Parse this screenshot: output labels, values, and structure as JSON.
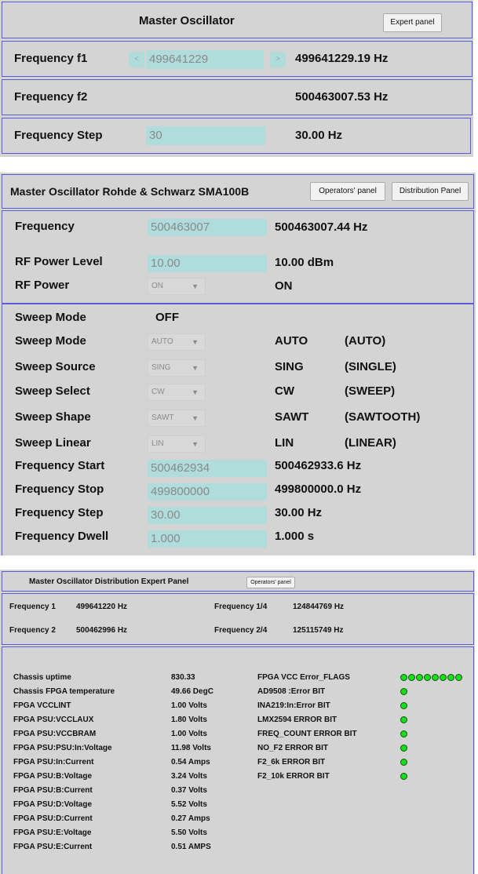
{
  "p1": {
    "title": "Master Oscillator",
    "expert_btn": "Expert panel",
    "f1_label": "Frequency f1",
    "f1_input": "499641229",
    "f1_dec": "<",
    "f1_inc": ">",
    "f1_value": "499641229.19 Hz",
    "f2_label": "Frequency f2",
    "f2_value": "500463007.53 Hz",
    "step_label": "Frequency Step",
    "step_input": "30",
    "step_value": "30.00 Hz"
  },
  "p2": {
    "title": "Master Oscillator Rohde & Schwarz  SMA100B",
    "operators_btn": "Operators' panel",
    "distribution_btn": "Distribution Panel",
    "freq_label": "Frequency",
    "freq_input": "500463007",
    "freq_value": "500463007.44 Hz",
    "rfpl_label": "RF Power Level",
    "rfpl_input": "10.00",
    "rfpl_value": "10.00 dBm",
    "rfp_label": "RF Power",
    "rfp_select": "ON",
    "rfp_value": "ON",
    "sweep_mode_state_label": "Sweep Mode",
    "sweep_mode_state": "OFF",
    "rows": [
      {
        "label": "Sweep Mode",
        "select": "AUTO",
        "value": "AUTO",
        "desc": "(AUTO)"
      },
      {
        "label": "Sweep Source",
        "select": "SING",
        "value": "SING",
        "desc": "(SINGLE)"
      },
      {
        "label": "Sweep Select",
        "select": "CW",
        "value": "CW",
        "desc": "(SWEEP)"
      },
      {
        "label": "Sweep Shape",
        "select": "SAWT",
        "value": "SAWT",
        "desc": "(SAWTOOTH)"
      },
      {
        "label": "Sweep Linear",
        "select": "LIN",
        "value": "LIN",
        "desc": "(LINEAR)"
      }
    ],
    "fields": [
      {
        "label": "Frequency Start",
        "input": "500462934",
        "value": "500462933.6 Hz"
      },
      {
        "label": "Frequency Stop",
        "input": "499800000",
        "value": "499800000.0 Hz"
      },
      {
        "label": "Frequency Step",
        "input": "30.00",
        "value": "30.00 Hz"
      },
      {
        "label": "Frequency Dwell",
        "input": "1.000",
        "value": "1.000 s"
      }
    ]
  },
  "p3": {
    "title": "Master Oscillator Distribution Expert Panel",
    "operators_btn": "Operators' panel",
    "freqs": [
      {
        "label": "Frequency 1",
        "value": "499641220 Hz"
      },
      {
        "label": "Frequency 2",
        "value": "500462996 Hz"
      },
      {
        "label": "Frequency 1/4",
        "value": "124844769 Hz"
      },
      {
        "label": "Frequency 2/4",
        "value": "125115749 Hz"
      }
    ],
    "status": [
      {
        "label": "Chassis uptime",
        "value": "830.33"
      },
      {
        "label": "Chassis FPGA temperature",
        "value": "49.66 DegC"
      },
      {
        "label": "FPGA VCCLINT",
        "value": "1.00 Volts"
      },
      {
        "label": "FPGA PSU:VCCLAUX",
        "value": "1.80 Volts"
      },
      {
        "label": "FPGA PSU:VCCBRAM",
        "value": "1.00 Volts"
      },
      {
        "label": "FPGA PSU:PSU:In:Voltage",
        "value": "11.98 Volts"
      },
      {
        "label": "FPGA PSU:In:Current",
        "value": "0.54 Amps"
      },
      {
        "label": "FPGA PSU:B:Voltage",
        "value": "3.24 Volts"
      },
      {
        "label": "FPGA PSU:B:Current",
        "value": "0.37 Volts"
      },
      {
        "label": "FPGA PSU:D:Voltage",
        "value": "5.52 Volts"
      },
      {
        "label": "FPGA PSU:D:Current",
        "value": "0.27 Amps"
      },
      {
        "label": "FPGA PSU:E:Voltage",
        "value": "5.50 Volts"
      },
      {
        "label": "FPGA PSU:E:Current",
        "value": "0.51 AMPS"
      }
    ],
    "flags": [
      {
        "label": "FPGA VCC Error_FLAGS"
      },
      {
        "label": "AD9508 :Error BIT"
      },
      {
        "label": "INA219:In:Error BIT"
      },
      {
        "label": "LMX2594 ERROR BIT"
      },
      {
        "label": "FREQ_COUNT ERROR BIT"
      },
      {
        "label": "NO_F2 ERROR BIT"
      },
      {
        "label": "F2_6k ERROR BIT"
      },
      {
        "label": "F2_10k ERROR BIT"
      }
    ],
    "led_color": "#16e016"
  }
}
